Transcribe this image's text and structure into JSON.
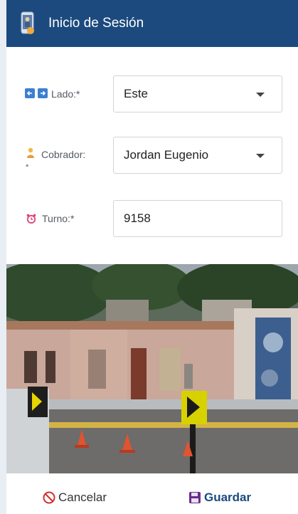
{
  "header": {
    "title": "Inicio de Sesión"
  },
  "form": {
    "lado": {
      "label": "Lado:*",
      "value": "Este"
    },
    "cobrador": {
      "label": "Cobrador:",
      "asterisk": "*",
      "value": "Jordan Eugenio"
    },
    "turno": {
      "label": "Turno:*",
      "value": "9158"
    }
  },
  "footer": {
    "cancel_label": "Cancelar",
    "save_label": "Guardar"
  },
  "colors": {
    "header_bg": "#1c4a7e",
    "cancel_icon": "#d0312d",
    "save_icon": "#6a2c8a"
  },
  "icons": [
    "phone-user-icon",
    "arrow-left-icon",
    "arrow-right-icon",
    "person-icon",
    "alarm-clock-icon",
    "cancel-icon",
    "floppy-disk-icon",
    "chevron-down-icon"
  ]
}
